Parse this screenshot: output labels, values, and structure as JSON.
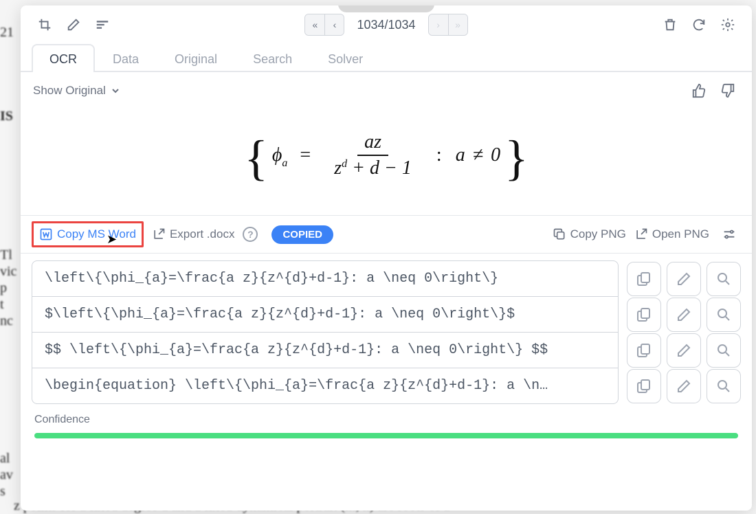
{
  "bg_text": {
    "line1": "21",
    "line2": "IS",
    "line3": "Tl",
    "line4": "vic",
    "line5": "p",
    "line6": "t",
    "line7": "nc",
    "line8": "al",
    "line9": "av",
    "line10": "s",
    "bottom": "z points for a fixed degree d and a fixed dynamical portrait (m, n) are roots of a"
  },
  "pager": {
    "current": "1034",
    "total": "1034",
    "counter": "1034/1034"
  },
  "tabs": [
    {
      "label": "OCR",
      "active": true
    },
    {
      "label": "Data",
      "active": false
    },
    {
      "label": "Original",
      "active": false
    },
    {
      "label": "Search",
      "active": false
    },
    {
      "label": "Solver",
      "active": false
    }
  ],
  "show_original_label": "Show Original",
  "equation": {
    "latex_core": "\\left\\{\\phi_{a}=\\frac{a z}{z^{d}+d-1}: a \\neq 0\\right\\}",
    "parts": {
      "phi": "ϕ",
      "sub_a": "a",
      "eq": "=",
      "num": "az",
      "den_z": "z",
      "den_sup": "d",
      "den_rest": " + d − 1",
      "colon": ":",
      "cond_a": "a",
      "neq": "≠",
      "zero": "0"
    }
  },
  "actions": {
    "copy_word": "Copy MS Word",
    "export_docx": "Export .docx",
    "copied_badge": "COPIED",
    "copy_png": "Copy PNG",
    "open_png": "Open PNG"
  },
  "code_rows": [
    {
      "text": "\\left\\{\\phi_{a}=\\frac{a z}{z^{d}+d-1}: a \\neq 0\\right\\}"
    },
    {
      "text": "$\\left\\{\\phi_{a}=\\frac{a z}{z^{d}+d-1}: a \\neq 0\\right\\}$"
    },
    {
      "text": "$$ \\left\\{\\phi_{a}=\\frac{a z}{z^{d}+d-1}: a \\neq 0\\right\\} $$"
    },
    {
      "text": "\\begin{equation} \\left\\{\\phi_{a}=\\frac{a z}{z^{d}+d-1}: a \\n…"
    }
  ],
  "confidence_label": "Confidence",
  "confidence_percent": 100
}
